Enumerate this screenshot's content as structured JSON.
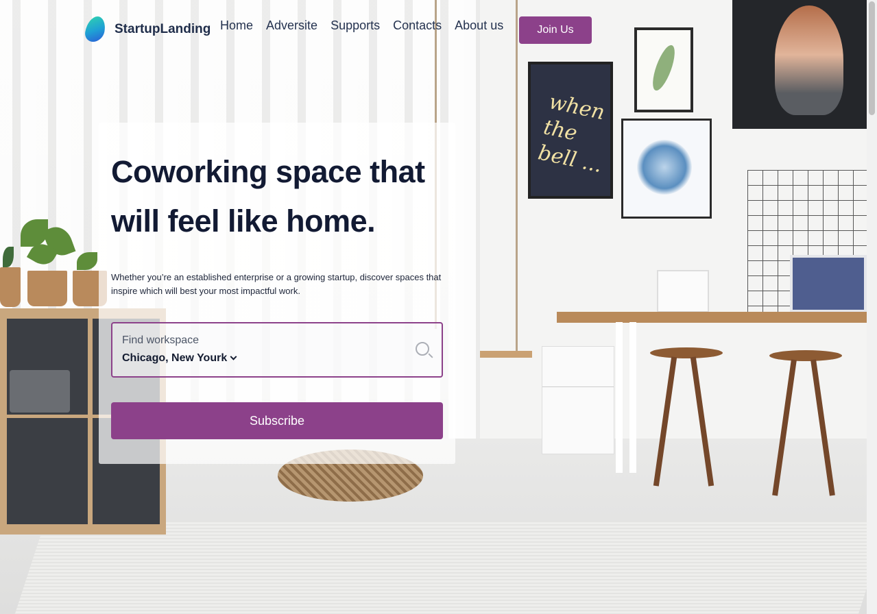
{
  "brand": {
    "name": "StartupLanding",
    "logo_icon": "startup-logo-icon",
    "accent": "#8c418a"
  },
  "nav": {
    "items": [
      "Home",
      "Adversite",
      "Supports",
      "Contacts",
      "About us"
    ],
    "cta_label": "Join Us"
  },
  "hero": {
    "headline": "Coworking space that will feel like home.",
    "subtitle": "Whether you’re an established enterprise or a growing startup, discover spaces that inspire which will best your most impactful work.",
    "finder": {
      "label": "Find workspace",
      "value": "Chicago, New Yourk",
      "icon": "search-icon"
    },
    "subscribe_label": "Subscribe"
  },
  "background": {
    "poster_text": "when the bell ..."
  }
}
